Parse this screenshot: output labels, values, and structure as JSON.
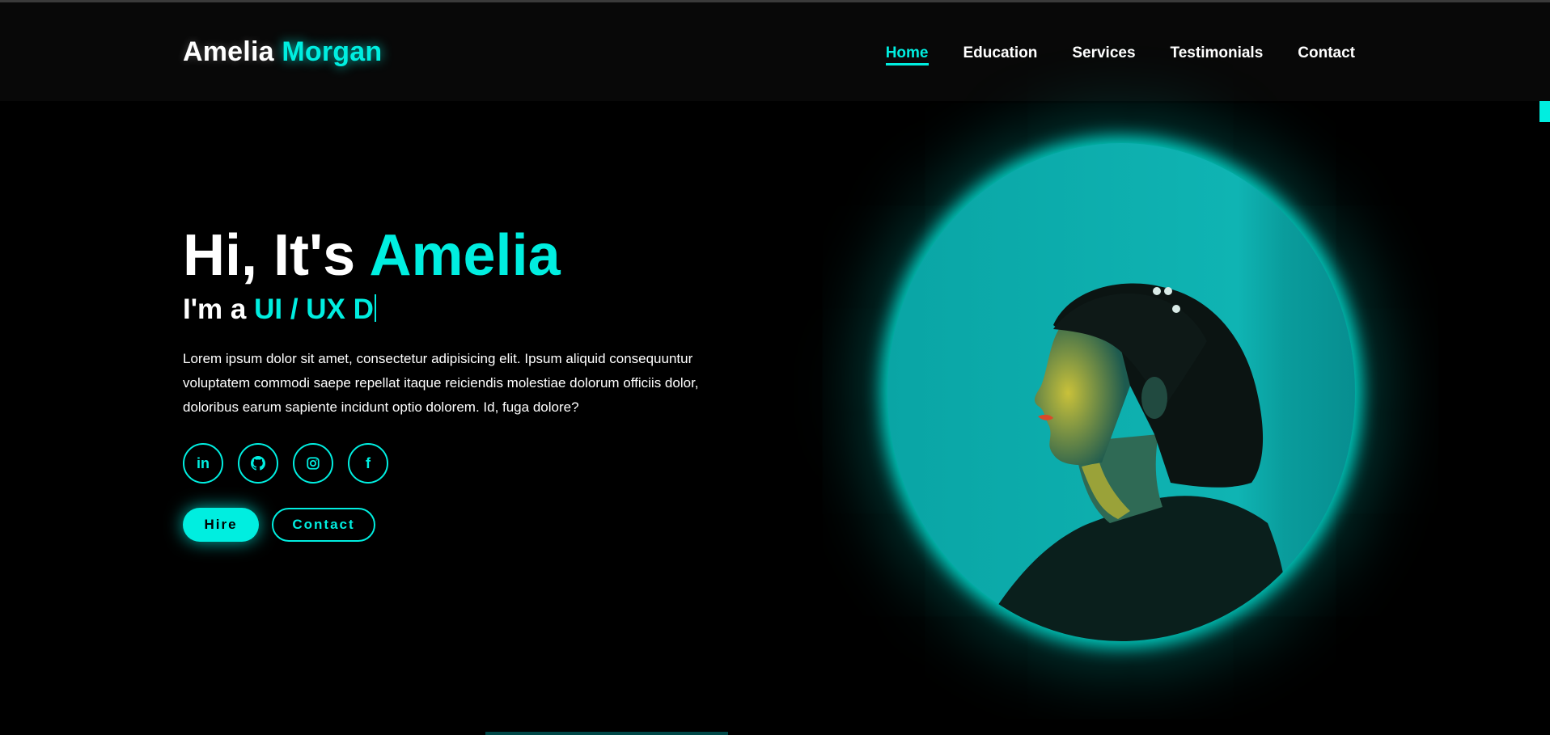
{
  "header": {
    "logo_first": "Amelia",
    "logo_last": "Morgan",
    "nav": [
      {
        "label": "Home",
        "active": true
      },
      {
        "label": "Education",
        "active": false
      },
      {
        "label": "Services",
        "active": false
      },
      {
        "label": "Testimonials",
        "active": false
      },
      {
        "label": "Contact",
        "active": false
      }
    ]
  },
  "hero": {
    "greeting": "Hi, It's",
    "name": "Amelia",
    "role_prefix": "I'm a",
    "role_typed": "UI / UX D",
    "description": "Lorem ipsum dolor sit amet, consectetur adipisicing elit. Ipsum aliquid consequuntur voluptatem commodi saepe repellat itaque reiciendis molestiae dolorum officiis dolor, doloribus earum sapiente incidunt optio dolorem. Id, fuga dolore?"
  },
  "socials": [
    {
      "name": "linkedin-icon",
      "glyph": "in"
    },
    {
      "name": "github-icon"
    },
    {
      "name": "instagram-icon"
    },
    {
      "name": "facebook-icon",
      "glyph": "f"
    }
  ],
  "buttons": {
    "hire": "Hire",
    "contact": "Contact"
  },
  "colors": {
    "accent": "#00eee0",
    "background": "#000000",
    "header_bg": "#080808"
  }
}
